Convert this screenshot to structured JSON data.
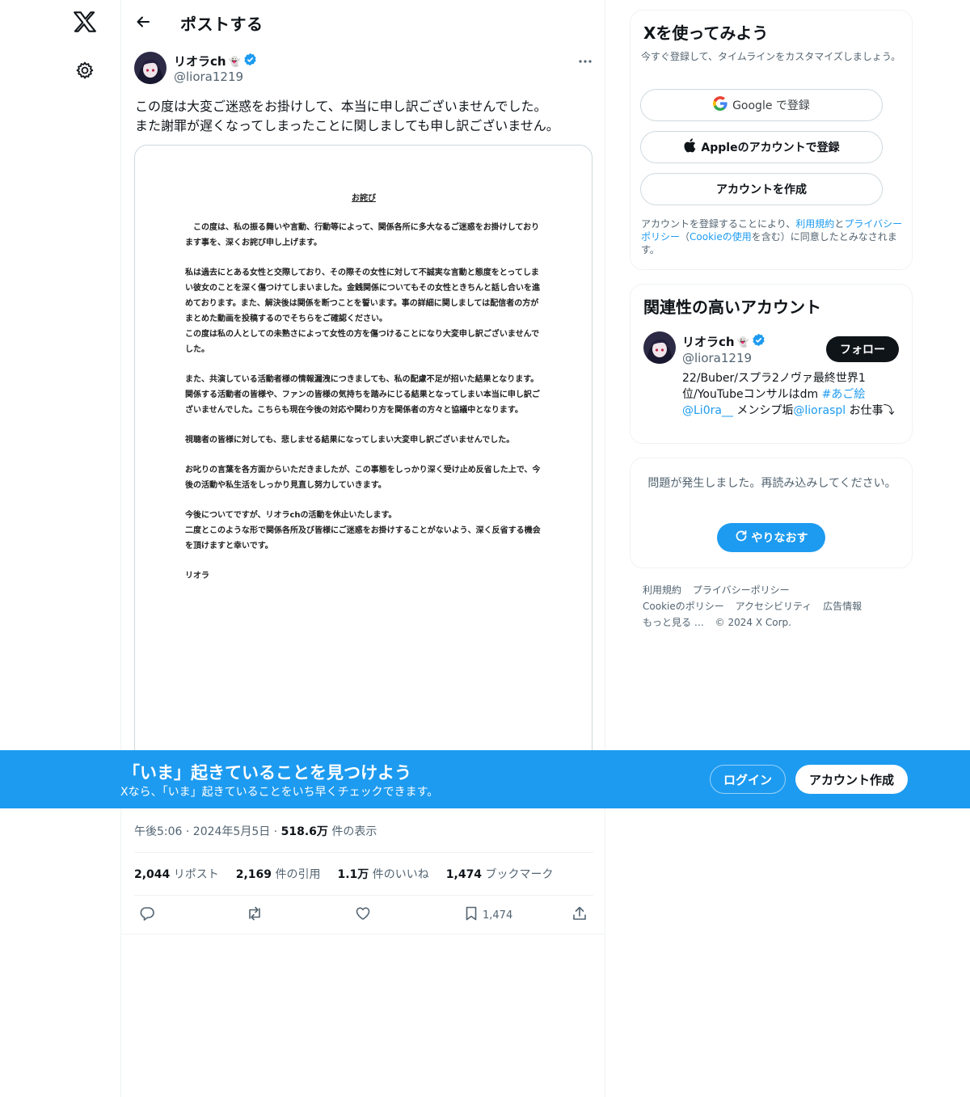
{
  "header": {
    "title": "ポストする"
  },
  "post": {
    "author_name": "リオラch",
    "author_emoji": "👻",
    "author_handle": "@liora1219",
    "text_line1": "この度は大変ご迷惑をお掛けして、本当に申し訳ございませんでした。",
    "text_line2": "また謝罪が遅くなってしまったことに関しましても申し訳ございません。",
    "image_doc": {
      "title": "お詫び",
      "paragraphs": [
        "　この度は、私の振る舞いや言動、行動等によって、関係各所に多大なるご迷惑をお掛けしております事を、深くお詫び申し上げます。",
        "私は過去にとある女性と交際しており、その際その女性に対して不誠実な言動と態度をとってしまい彼女のことを深く傷つけてしまいました。金銭関係についてもその女性ときちんと話し合いを進めております。また、解決後は関係を断つことを誓います。事の詳細に関しましては配信者の方がまとめた動画を投稿するのでそちらをご確認ください。\nこの度は私の人としての未熟さによって女性の方を傷つけることになり大変申し訳ございませんでした。",
        "また、共演している活動者様の情報漏洩につきましても、私の配慮不足が招いた結果となります。関係する活動者の皆様や、ファンの皆様の気持ちを踏みにじる結果となってしまい本当に申し訳ございませんでした。こちらも現在今後の対応や関わり方を関係者の方々と協議中となります。",
        "視聴者の皆様に対しても、悲しませる結果になってしまい大変申し訳ございませんでした。",
        "お叱りの言葉を各方面からいただきましたが、この事態をしっかり深く受け止め反省した上で、今後の活動や私生活をしっかり見直し努力していきます。",
        "今後についてですが、リオラchの活動を休止いたします。\n二度とこのような形で関係各所及び皆様にご迷惑をお掛けすることがないよう、深く反省する機会を頂けますと幸いです。",
        "リオラ"
      ]
    },
    "time": "午後5:06 · 2024年5月5日 · ",
    "views_count": "518.6万",
    "views_label": " 件の表示",
    "stats": [
      {
        "count": "2,044",
        "label": " リポスト"
      },
      {
        "count": "2,169",
        "label": " 件の引用"
      },
      {
        "count": "1.1万",
        "label": " 件のいいね"
      },
      {
        "count": "1,474",
        "label": " ブックマーク"
      }
    ],
    "bookmark_count": "1,474"
  },
  "signup_card": {
    "title": "Xを使ってみよう",
    "subtitle": "今すぐ登録して、タイムラインをカスタマイズしましょう。",
    "google_label": "Google で登録",
    "apple_label": "Appleのアカウントで登録",
    "create_label": "アカウントを作成",
    "terms_prefix": "アカウントを登録することにより、",
    "terms_link": "利用規約",
    "terms_and": "と",
    "privacy_link": "プライバシーポリシー",
    "terms_paren_open": "（",
    "cookie_link": "Cookieの使用",
    "terms_suffix": "を含む）に同意したとみなされます。"
  },
  "related_card": {
    "title": "関連性の高いアカウント",
    "name": "リオラch",
    "emoji": "👻",
    "handle": "@liora1219",
    "follow_label": "フォロー",
    "bio_text1": "22/Buber/スプラ2ノヴァ最終世界1位/YouTubeコンサルはdm ",
    "bio_hashtag": "#あご絵",
    "bio_mention1": "@Li0ra__",
    "bio_text2": " メンシプ垢",
    "bio_mention2": "@lioraspl",
    "bio_text3": " お仕事⤵︎"
  },
  "error_card": {
    "message": "問題が発生しました。再読み込みしてください。",
    "retry_label": "やりなおす"
  },
  "footer": {
    "links": [
      "利用規約",
      "プライバシーポリシー",
      "Cookieのポリシー",
      "アクセシビリティ",
      "広告情報",
      "もっと見る …"
    ],
    "copyright": "© 2024 X Corp."
  },
  "banner": {
    "title": "「いま」起きていることを見つけよう",
    "subtitle": "Xなら、「いま」起きていることをいち早くチェックできます。",
    "login_label": "ログイン",
    "signup_label": "アカウント作成"
  },
  "colors": {
    "accent": "#1d9bf0",
    "text": "#0f1419",
    "muted": "#536471",
    "border": "#eff3f4"
  },
  "icons": [
    "x-logo-icon",
    "gear-icon",
    "back-arrow-icon",
    "verified-badge-icon",
    "more-icon",
    "reply-icon",
    "repost-icon",
    "like-icon",
    "bookmark-icon",
    "share-icon",
    "google-icon",
    "apple-icon",
    "refresh-icon"
  ]
}
